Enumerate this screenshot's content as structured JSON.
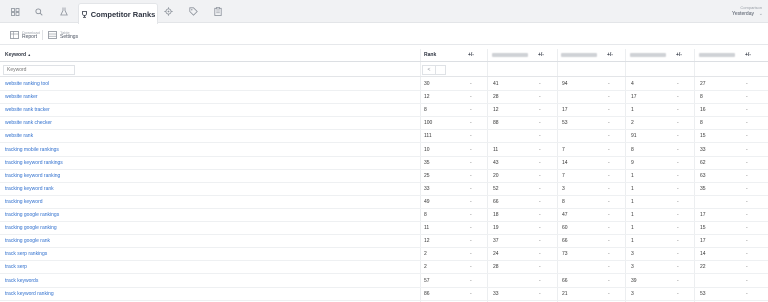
{
  "tabs": {
    "icons": [
      "dashboard-icon",
      "search-icon",
      "flask-icon",
      "settings-icon",
      "tag-icon",
      "clipboard-icon"
    ],
    "active_label": "Competitor Ranks"
  },
  "comparison": {
    "label": "Comparison",
    "value": "Yesterday"
  },
  "toolbar": {
    "report": {
      "top": "Download",
      "label": "Report"
    },
    "settings": {
      "top": "Table",
      "label": "Settings"
    }
  },
  "table": {
    "headers": {
      "keyword": "Keyword",
      "sort": "▲",
      "rank": "Rank",
      "diff": "+/-"
    },
    "filter": {
      "keyword_placeholder": "Keyword",
      "rank_filter": "<"
    },
    "rows": [
      {
        "kw": "website ranking tool",
        "rank": "30",
        "c1": "41",
        "c2": "94",
        "c3": "4",
        "c4": "27"
      },
      {
        "kw": "website ranker",
        "rank": "12",
        "c1": "28",
        "c2": "",
        "c3": "17",
        "c4": "8"
      },
      {
        "kw": "website rank tracker",
        "rank": "8",
        "c1": "12",
        "c2": "17",
        "c3": "1",
        "c4": "16"
      },
      {
        "kw": "website rank checker",
        "rank": "100",
        "c1": "88",
        "c2": "53",
        "c3": "2",
        "c4": "8"
      },
      {
        "kw": "website rank",
        "rank": "111",
        "c1": "",
        "c2": "",
        "c3": "91",
        "c4": "15"
      },
      {
        "kw": "tracking mobile rankings",
        "rank": "10",
        "c1": "11",
        "c2": "7",
        "c3": "8",
        "c4": "33"
      },
      {
        "kw": "tracking keyword rankings",
        "rank": "35",
        "c1": "43",
        "c2": "14",
        "c3": "9",
        "c4": "62"
      },
      {
        "kw": "tracking keyword ranking",
        "rank": "25",
        "c1": "20",
        "c2": "7",
        "c3": "1",
        "c4": "63"
      },
      {
        "kw": "tracking keyword rank",
        "rank": "33",
        "c1": "52",
        "c2": "3",
        "c3": "1",
        "c4": "35"
      },
      {
        "kw": "tracking keyword",
        "rank": "49",
        "c1": "66",
        "c2": "8",
        "c3": "1",
        "c4": ""
      },
      {
        "kw": "tracking google rankings",
        "rank": "8",
        "c1": "18",
        "c2": "47",
        "c3": "1",
        "c4": "17"
      },
      {
        "kw": "tracking google ranking",
        "rank": "11",
        "c1": "19",
        "c2": "60",
        "c3": "1",
        "c4": "15"
      },
      {
        "kw": "tracking google rank",
        "rank": "12",
        "c1": "37",
        "c2": "66",
        "c3": "1",
        "c4": "17"
      },
      {
        "kw": "track serp rankings",
        "rank": "2",
        "c1": "24",
        "c2": "73",
        "c3": "3",
        "c4": "14"
      },
      {
        "kw": "track serp",
        "rank": "2",
        "c1": "28",
        "c2": "",
        "c3": "3",
        "c4": "22"
      },
      {
        "kw": "track keywords",
        "rank": "57",
        "c1": "",
        "c2": "66",
        "c3": "39",
        "c4": ""
      },
      {
        "kw": "track keyword ranking",
        "rank": "86",
        "c1": "33",
        "c2": "21",
        "c3": "3",
        "c4": "53"
      }
    ],
    "dash": "-"
  },
  "colors": {
    "link": "#2f6fce",
    "active_tab_bg": "#ffffff",
    "topbar_bg": "#f1f2f4"
  }
}
